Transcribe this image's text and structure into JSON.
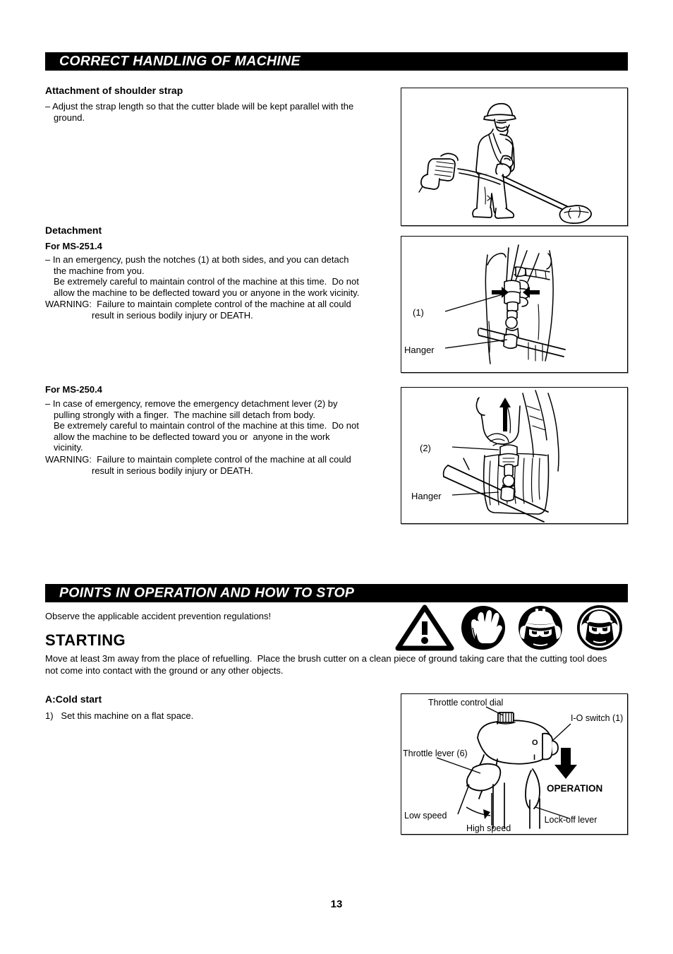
{
  "page": {
    "number": "13"
  },
  "section1": {
    "header": "CORRECT HANDLING OF MACHINE",
    "attachment_heading": "Attachment of shoulder strap",
    "attachment_line1": "– Adjust the strap length so that the cutter blade will be kept parallel with the",
    "attachment_line2": "ground.",
    "detachment_heading": "Detachment",
    "ms251_heading": "For MS-251.4",
    "ms251_line1": "– In an emergency, push the notches (1) at both sides, and you can detach",
    "ms251_line2": "the machine from you.",
    "ms251_line3": "Be extremely careful to maintain control of the machine at this time.  Do not",
    "ms251_line4": "allow the machine to be deflected toward you or anyone in the work vicinity.",
    "ms251_warning_line1": "WARNING:  Failure to maintain complete control of the machine at all could",
    "ms251_warning_line2": "result in serious bodily injury or DEATH.",
    "ms250_heading": "For MS-250.4",
    "ms250_line1": "– In case of emergency, remove the emergency detachment lever (2) by",
    "ms250_line2": "pulling strongly with a finger.  The machine sill detach from body.",
    "ms250_line3": "Be extremely careful to maintain control of the machine at this time.  Do not",
    "ms250_line4": "allow the machine to be deflected toward you or  anyone in the work",
    "ms250_line5": "vicinity.",
    "ms250_warning_line1": "WARNING:  Failure to maintain complete control of the machine at all could",
    "ms250_warning_line2": "result in serious bodily injury or DEATH."
  },
  "figures": {
    "fig1_caption": "operator wearing shoulder strap with brush cutter",
    "fig2_label_1": "(1)",
    "fig2_label_hanger": "Hanger",
    "fig3_label_2": "(2)",
    "fig3_label_hanger": "Hanger"
  },
  "section2": {
    "header": "POINTS IN OPERATION AND HOW TO STOP",
    "observe_text": "Observe the applicable accident prevention regulations!",
    "starting_heading": "STARTING",
    "starting_line1": "Move at least 3m away from the place of refuelling.  Place the brush cutter on a clean piece of ground taking care that the cutting tool does",
    "starting_line2": "not come into contact with the ground or any other objects.",
    "coldstart_heading": "A:Cold start",
    "coldstart_step1": "1)   Set this machine on a flat space.",
    "pictograms": [
      {
        "name": "warning-triangle-icon",
        "label": "General warning"
      },
      {
        "name": "protective-gloves-icon",
        "label": "Wear protective gloves"
      },
      {
        "name": "head-protection-icon",
        "label": "Wear helmet, eye and ear protection"
      },
      {
        "name": "eye-ear-protection-icon",
        "label": "Wear eye and ear protection"
      }
    ]
  },
  "throttle_figure": {
    "label_throttle_dial": "Throttle control dial",
    "label_io_switch": "I-O switch (1)",
    "label_throttle_lever": "Throttle lever (6)",
    "label_operation": "OPERATION",
    "label_low_speed": "Low speed",
    "label_high_speed": "High speed",
    "label_lock_off": "Lock-off lever",
    "switch_o": "O",
    "switch_i": "I"
  },
  "colors": {
    "ink": "#000000",
    "paper": "#ffffff",
    "frame_shadow": "#9a9a9a"
  }
}
